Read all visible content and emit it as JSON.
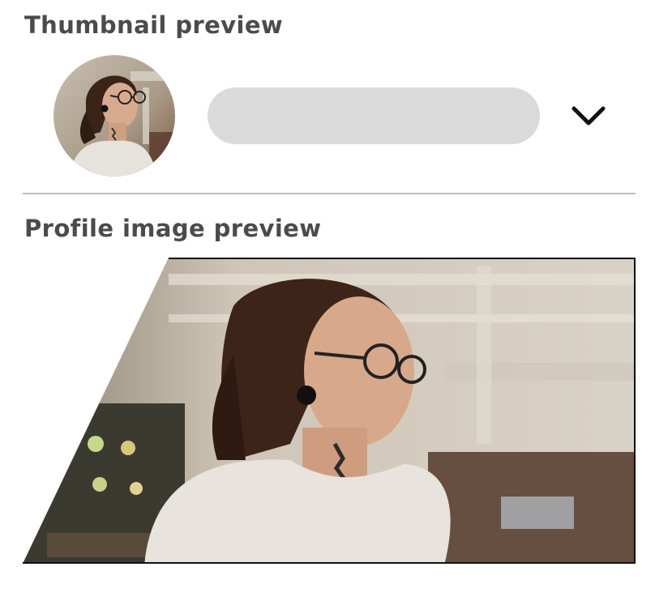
{
  "thumbnail": {
    "title": "Thumbnail preview",
    "selector_value": ""
  },
  "profile": {
    "title": "Profile image preview"
  },
  "icons": {
    "dropdown": "chevron-down-icon"
  },
  "colors": {
    "title_text": "#4b4b4b",
    "selector_fill": "#dadada",
    "divider": "#bcbcbc"
  }
}
